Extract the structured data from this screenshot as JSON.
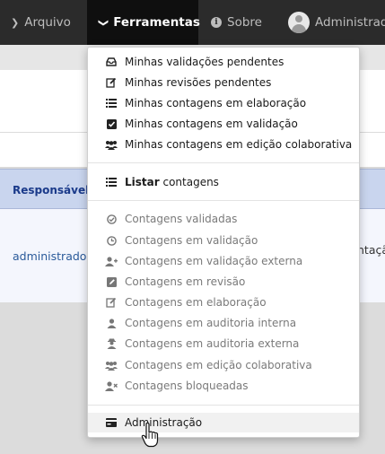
{
  "navbar": {
    "arquivo": "Arquivo",
    "ferramentas": "Ferramentas",
    "sobre": "Sobre",
    "user": "Administrad"
  },
  "table": {
    "header_responsavel": "Responsável",
    "row_user": "administrador",
    "row_right": "ntaçã"
  },
  "menu": {
    "group1": [
      {
        "icon": "inbox-icon",
        "label": "Minhas validações pendentes"
      },
      {
        "icon": "edit-icon",
        "label": "Minhas revisões pendentes"
      },
      {
        "icon": "list-icon",
        "label": "Minhas contagens em elaboração"
      },
      {
        "icon": "check-square-icon",
        "label": "Minhas contagens em validação"
      },
      {
        "icon": "users-icon",
        "label": "Minhas contagens em edição colaborativa"
      }
    ],
    "listar_bold": "Listar",
    "listar_rest": " contagens",
    "group2": [
      {
        "icon": "check-circle-icon",
        "label": "Contagens validadas"
      },
      {
        "icon": "clock-icon",
        "label": "Contagens em validação"
      },
      {
        "icon": "user-plus-icon",
        "label": "Contagens em validação externa"
      },
      {
        "icon": "pencil-square-icon",
        "label": "Contagens em revisão"
      },
      {
        "icon": "edit-icon",
        "label": "Contagens em elaboração"
      },
      {
        "icon": "user-icon",
        "label": "Contagens em auditoria interna"
      },
      {
        "icon": "user-secret-icon",
        "label": "Contagens em auditoria externa"
      },
      {
        "icon": "users-icon",
        "label": "Contagens em edição colaborativa"
      },
      {
        "icon": "user-times-icon",
        "label": "Contagens bloqueadas"
      }
    ],
    "administracao": "Administração"
  }
}
